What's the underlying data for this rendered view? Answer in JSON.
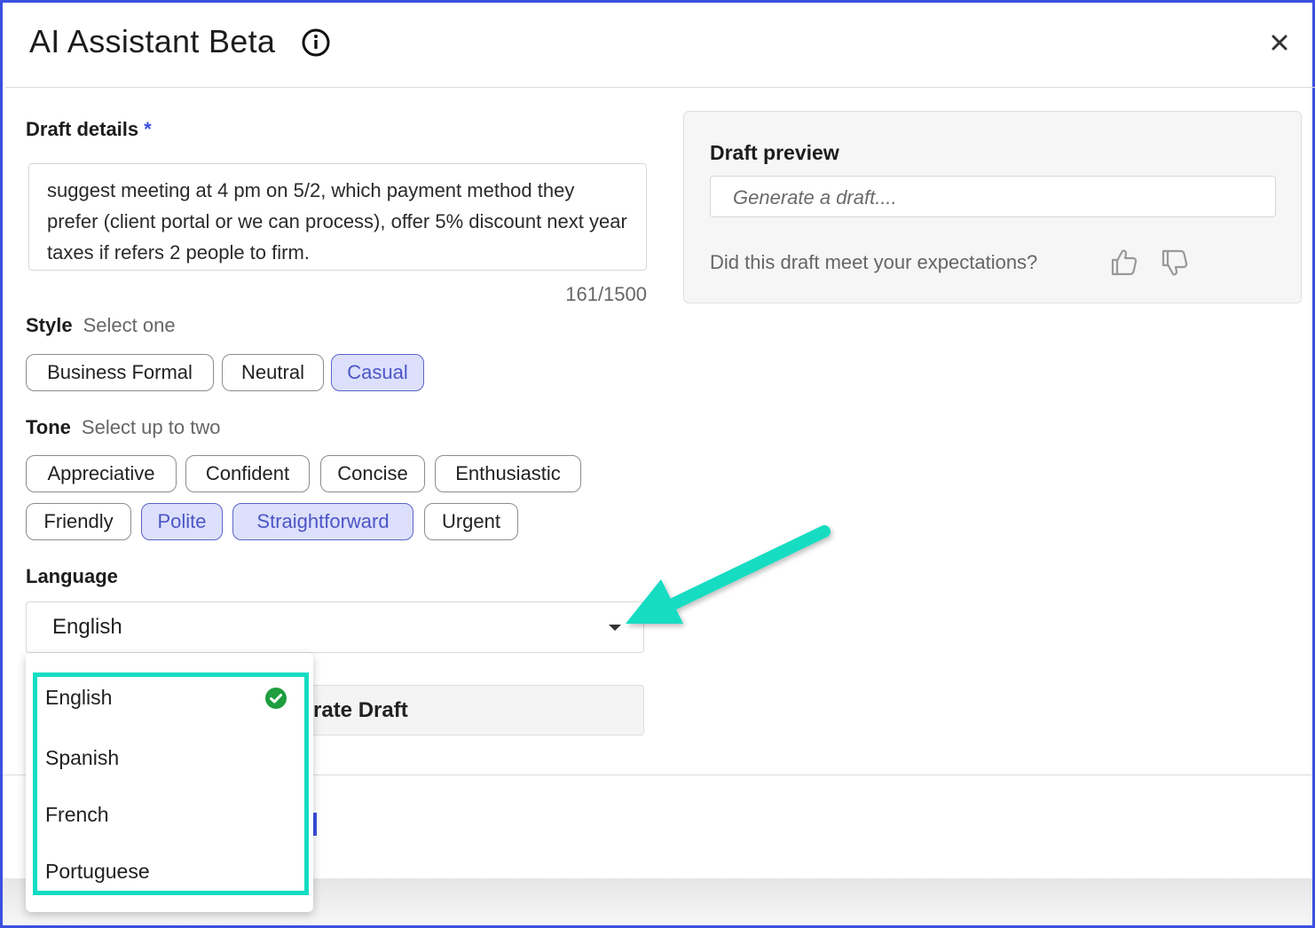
{
  "header": {
    "title": "AI Assistant Beta",
    "close_label": "×"
  },
  "draft_details": {
    "label": "Draft details",
    "required_mark": "*",
    "value": "suggest meeting at 4 pm on 5/2, which payment method they prefer (client portal or we can process), offer 5% discount next year taxes if refers 2 people to firm.",
    "counter": "161/1500"
  },
  "style": {
    "label": "Style",
    "hint": "Select one",
    "options": [
      {
        "label": "Business Formal",
        "selected": false
      },
      {
        "label": "Neutral",
        "selected": false
      },
      {
        "label": "Casual",
        "selected": true
      }
    ]
  },
  "tone": {
    "label": "Tone",
    "hint": "Select up to two",
    "options": [
      {
        "label": "Appreciative",
        "selected": false
      },
      {
        "label": "Confident",
        "selected": false
      },
      {
        "label": "Concise",
        "selected": false
      },
      {
        "label": "Enthusiastic",
        "selected": false
      },
      {
        "label": "Friendly",
        "selected": false
      },
      {
        "label": "Polite",
        "selected": true
      },
      {
        "label": "Straightforward",
        "selected": true
      },
      {
        "label": "Urgent",
        "selected": false
      }
    ]
  },
  "language": {
    "label": "Language",
    "selected": "English",
    "options": [
      {
        "label": "English",
        "checked": true
      },
      {
        "label": "Spanish",
        "checked": false
      },
      {
        "label": "French",
        "checked": false
      },
      {
        "label": "Portuguese",
        "checked": false
      }
    ]
  },
  "generate": {
    "label_visible": "rate Draft"
  },
  "preview": {
    "title": "Draft preview",
    "placeholder": "Generate a draft....",
    "feedback_question": "Did this draft meet your expectations?"
  },
  "colors": {
    "accent": "#3b4fe0",
    "chip_selected_bg": "#dde0fb",
    "annotation": "#13dcc2",
    "check_green": "#1e9e3e"
  },
  "icons": [
    "info-icon",
    "close-icon",
    "thumbs-up-icon",
    "thumbs-down-icon",
    "chevron-down-icon",
    "check-circle-icon"
  ]
}
